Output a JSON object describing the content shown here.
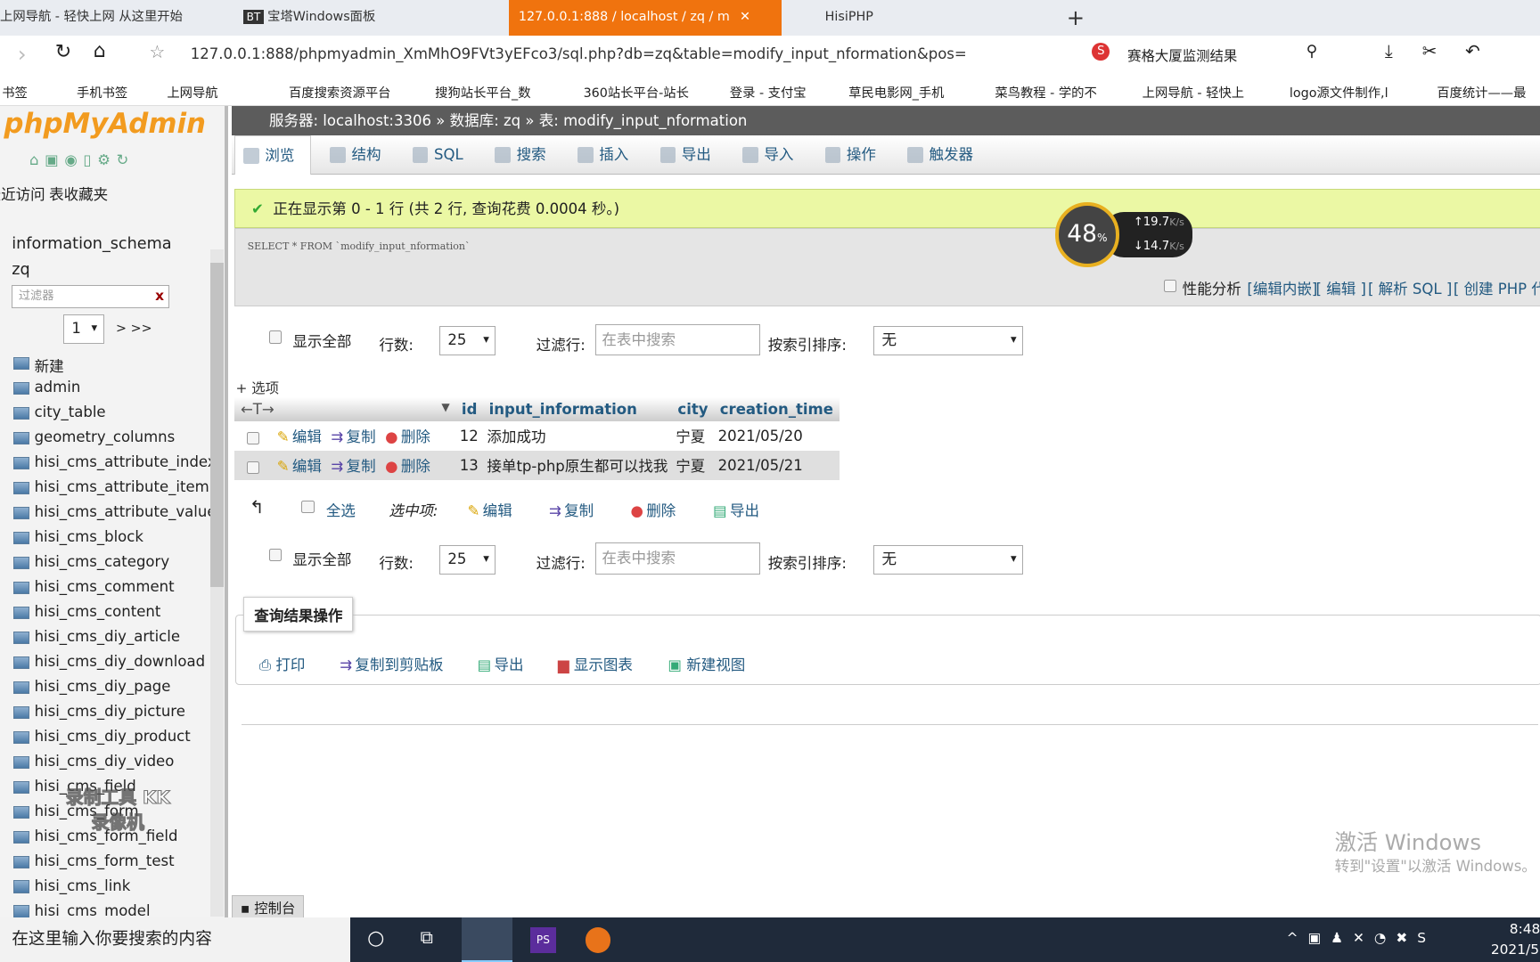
{
  "browser": {
    "tabs": [
      {
        "label": "上网导航 - 轻快上网 从这里开始"
      },
      {
        "label": "宝塔Windows面板",
        "icon": "BT"
      },
      {
        "label": "127.0.0.1:888 / localhost / zq / m",
        "active": true
      },
      {
        "label": "HisiPHP"
      }
    ],
    "url": "127.0.0.1:888/phpmyadmin_XmMhO9FVt3yEFco3/sql.php?db=zq&table=modify_input_nformation&pos=",
    "search_suggest": "赛格大厦监测结果",
    "bookmarks": [
      "书签",
      "手机书签",
      "上网导航",
      "百度搜索资源平台",
      "搜狗站长平台_数",
      "360站长平台-站长",
      "登录 - 支付宝",
      "草民电影网_手机",
      "菜鸟教程 - 学的不",
      "上网导航 - 轻快上",
      "logo源文件制作,l",
      "百度统计——最"
    ]
  },
  "sidebar": {
    "logo": "phpMyAdmin",
    "tabs": [
      "最近访问",
      "表收藏夹"
    ],
    "databases": [
      "information_schema",
      "zq"
    ],
    "filter_placeholder": "过滤器",
    "filter_clear": "x",
    "page": "1",
    "page_nav": "> >>",
    "new_label": "新建",
    "tables": [
      "admin",
      "city_table",
      "geometry_columns",
      "hisi_cms_attribute_index",
      "hisi_cms_attribute_item",
      "hisi_cms_attribute_value",
      "hisi_cms_block",
      "hisi_cms_category",
      "hisi_cms_comment",
      "hisi_cms_content",
      "hisi_cms_diy_article",
      "hisi_cms_diy_download",
      "hisi_cms_diy_page",
      "hisi_cms_diy_picture",
      "hisi_cms_diy_product",
      "hisi_cms_diy_video",
      "hisi_cms_field",
      "hisi_cms_form",
      "hisi_cms_form_field",
      "hisi_cms_form_test",
      "hisi_cms_link",
      "hisi_cms_model"
    ]
  },
  "breadcrumb": {
    "server": "服务器: localhost:3306",
    "database": "数据库: zq",
    "table": "表: modify_input_nformation"
  },
  "menu": [
    "浏览",
    "结构",
    "SQL",
    "搜索",
    "插入",
    "导出",
    "导入",
    "操作",
    "触发器"
  ],
  "result": {
    "message": "正在显示第 0 - 1 行 (共 2 行, 查询花费 0.0004 秒。)",
    "sql": "SELECT * FROM `modify_input_nformation`",
    "profiling": "性能分析",
    "links": [
      "[编辑内嵌]",
      "[ 编辑 ]",
      "[ 解析 SQL ]",
      "[ 创建 PHP 代"
    ]
  },
  "controls": {
    "show_all": "显示全部",
    "rows_label": "行数:",
    "rows": "25",
    "filter_label": "过滤行:",
    "filter_placeholder": "在表中搜索",
    "sort_label": "按索引排序:",
    "sort": "无",
    "options": "+ 选项"
  },
  "table": {
    "columns": [
      "id",
      "input_information",
      "city",
      "creation_time"
    ],
    "actions": [
      "编辑",
      "复制",
      "删除"
    ],
    "rows": [
      {
        "id": "12",
        "input_information": "添加成功",
        "city": "宁夏",
        "creation_time": "2021/05/20"
      },
      {
        "id": "13",
        "input_information": "接单tp-php原生都可以找我",
        "city": "宁夏",
        "creation_time": "2021/05/21"
      }
    ]
  },
  "bulk": {
    "select_all": "全选",
    "with_selected": "选中项:",
    "edit": "编辑",
    "copy": "复制",
    "delete": "删除",
    "export": "导出"
  },
  "query_ops": {
    "title": "查询结果操作",
    "items": [
      "打印",
      "复制到剪贴板",
      "导出",
      "显示图表",
      "新建视图"
    ]
  },
  "console": "控制台",
  "speed_widget": {
    "percent": "48",
    "unit": "%",
    "up": "19.7",
    "down": "14.7",
    "rate_unit": "K/s"
  },
  "watermark": {
    "activate": "激活 Windows",
    "activate_sub": "转到\"设置\"以激活 Windows。",
    "recorder": "录制工具 KK录像机"
  },
  "taskbar": {
    "search": "在这里输入你要搜索的内容",
    "time": "8:48",
    "date": "2021/5"
  }
}
